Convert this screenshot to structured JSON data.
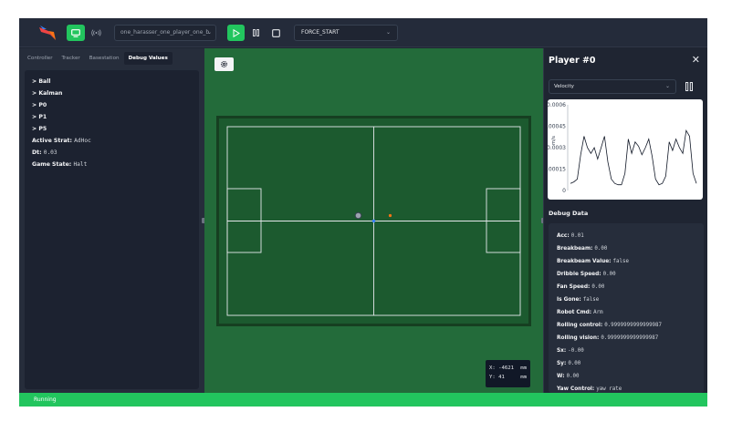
{
  "toolbar": {
    "logo": "raven-logo-icon",
    "view_button_icon": "monitor-icon",
    "radio_button_icon": "broadcast-icon",
    "scenario": "one_harasser_one_player_one_b",
    "play_icon": "play-icon",
    "pause_icon": "pause-icon",
    "stop_icon": "stop-icon",
    "command": "FORCE_START",
    "accent": "#22c55e"
  },
  "left": {
    "tabs": [
      {
        "label": "Controller"
      },
      {
        "label": "Tracker"
      },
      {
        "label": "Basestation"
      },
      {
        "label": "Debug Values"
      }
    ],
    "tree": [
      {
        "label": "> Ball"
      },
      {
        "label": "> Kalman"
      },
      {
        "label": "> P0"
      },
      {
        "label": "> P1"
      },
      {
        "label": "> P5"
      }
    ],
    "fields": [
      {
        "label": "Active Strat:",
        "value": "AdHoc"
      },
      {
        "label": "Dt:",
        "value": "0.03"
      },
      {
        "label": "Game State:",
        "value": "Halt"
      }
    ]
  },
  "field": {
    "settings_icon": "gear-icon",
    "coords": {
      "x_label": "X:",
      "x_value": "-4621",
      "x_unit": "mm",
      "y_label": "Y:",
      "y_value": "41",
      "y_unit": "mm"
    }
  },
  "right": {
    "title": "Player #0",
    "close_icon": "close-icon",
    "select": "Velocity",
    "chart_data": {
      "type": "line",
      "ylabel": "m/s",
      "yticks": [
        "0.0006",
        "0.00045",
        "0.0003",
        "0.00015",
        "0"
      ],
      "ylim": [
        0,
        0.0006
      ],
      "y": [
        5e-05,
        6e-05,
        8e-05,
        0.00025,
        0.00038,
        0.0003,
        0.00026,
        0.0003,
        0.00022,
        0.0003,
        0.00038,
        0.0002,
        8e-05,
        5e-05,
        4e-05,
        4e-05,
        0.00012,
        0.00036,
        0.00026,
        0.00034,
        0.00031,
        0.00025,
        0.0003,
        0.00036,
        0.00024,
        8e-05,
        4e-05,
        5e-05,
        0.0001,
        0.00034,
        0.00028,
        0.00036,
        0.0003,
        0.00026,
        0.00042,
        0.00038,
        0.00012,
        5e-05
      ]
    },
    "debug_title": "Debug Data",
    "debug": [
      {
        "label": "Acc:",
        "value": "0.01"
      },
      {
        "label": "Breakbeam:",
        "value": "0.00"
      },
      {
        "label": "Breakbeam Value:",
        "value": "false"
      },
      {
        "label": "Dribble Speed:",
        "value": "0.00"
      },
      {
        "label": "Fan Speed:",
        "value": "0.00"
      },
      {
        "label": "Is Gone:",
        "value": "false"
      },
      {
        "label": "Robot Cmd:",
        "value": "Arm"
      },
      {
        "label": "Rolling control:",
        "value": "0.9999999999999987"
      },
      {
        "label": "Rolling vision:",
        "value": "0.9999999999999987"
      },
      {
        "label": "Sx:",
        "value": "-0.00"
      },
      {
        "label": "Sy:",
        "value": "0.00"
      },
      {
        "label": "W:",
        "value": "0.00"
      },
      {
        "label": "Yaw Control:",
        "value": "yaw rate"
      }
    ]
  },
  "status": {
    "text": "Running",
    "color": "#22c55e"
  }
}
